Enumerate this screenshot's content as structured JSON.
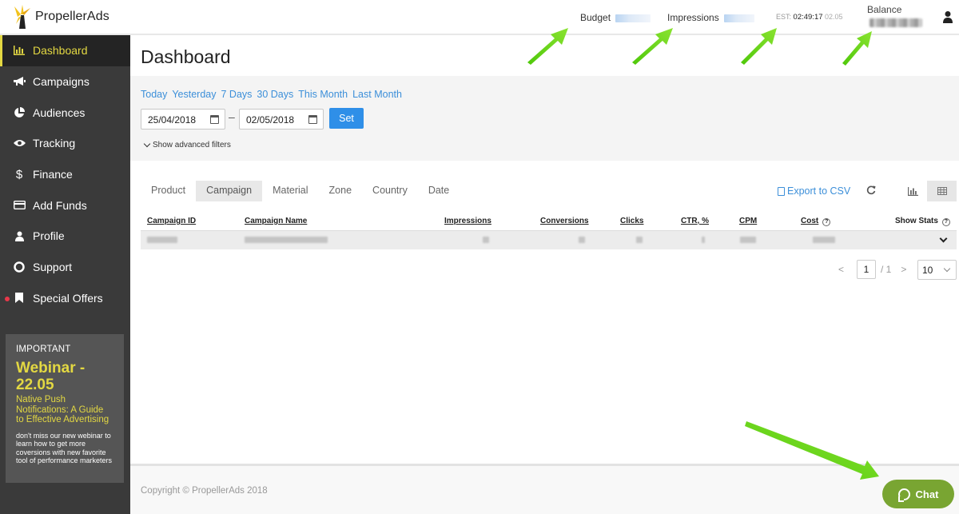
{
  "header": {
    "logo_text": "PropellerAds",
    "budget_label": "Budget",
    "impressions_label": "Impressions",
    "est_label": "EST:",
    "est_time": "02:49:17",
    "est_date": "02.05",
    "balance_label": "Balance"
  },
  "sidebar": {
    "items": [
      {
        "label": "Dashboard",
        "icon": "bar-chart-icon"
      },
      {
        "label": "Campaigns",
        "icon": "megaphone-icon"
      },
      {
        "label": "Audiences",
        "icon": "pie-chart-icon"
      },
      {
        "label": "Tracking",
        "icon": "eye-icon"
      },
      {
        "label": "Finance",
        "icon": "dollar-icon"
      },
      {
        "label": "Add Funds",
        "icon": "credit-card-icon"
      },
      {
        "label": "Profile",
        "icon": "user-icon"
      },
      {
        "label": "Support",
        "icon": "lifebuoy-icon"
      },
      {
        "label": "Special Offers",
        "icon": "bookmark-icon"
      }
    ],
    "promo": {
      "label": "IMPORTANT",
      "title": "Webinar - 22.05",
      "subtitle": "Native Push Notifications: A Guide to Effective Advertising",
      "description": "don't miss our new webinar to learn how to get more coversions with new favorite tool of performance marketers"
    }
  },
  "main": {
    "title": "Dashboard",
    "quick_ranges": [
      "Today",
      "Yesterday",
      "7 Days",
      "30 Days",
      "This Month",
      "Last Month"
    ],
    "date_from": "25/04/2018",
    "date_separator": "–",
    "date_to": "02/05/2018",
    "set_label": "Set",
    "advanced_filters_label": "Show advanced filters",
    "tabs": [
      "Product",
      "Campaign",
      "Material",
      "Zone",
      "Country",
      "Date"
    ],
    "active_tab": "Campaign",
    "export_label": "Export to CSV",
    "columns": [
      "Campaign ID",
      "Campaign Name",
      "Impressions",
      "Conversions",
      "Clicks",
      "CTR, %",
      "CPM",
      "Cost",
      "Show Stats"
    ],
    "pagination": {
      "prev": "<",
      "current": "1",
      "total": "/ 1",
      "next": ">",
      "per_page": "10"
    }
  },
  "footer": {
    "copyright": "Copyright © PropellerAds 2018",
    "chat_label": "Chat"
  },
  "colors": {
    "sidebar_bg": "#3a3a3a",
    "accent_yellow": "#e3d842",
    "link_blue": "#3c8fd9",
    "button_blue": "#2f8fe8",
    "chat_green": "#79a532",
    "arrow_green": "#6fd21b"
  }
}
